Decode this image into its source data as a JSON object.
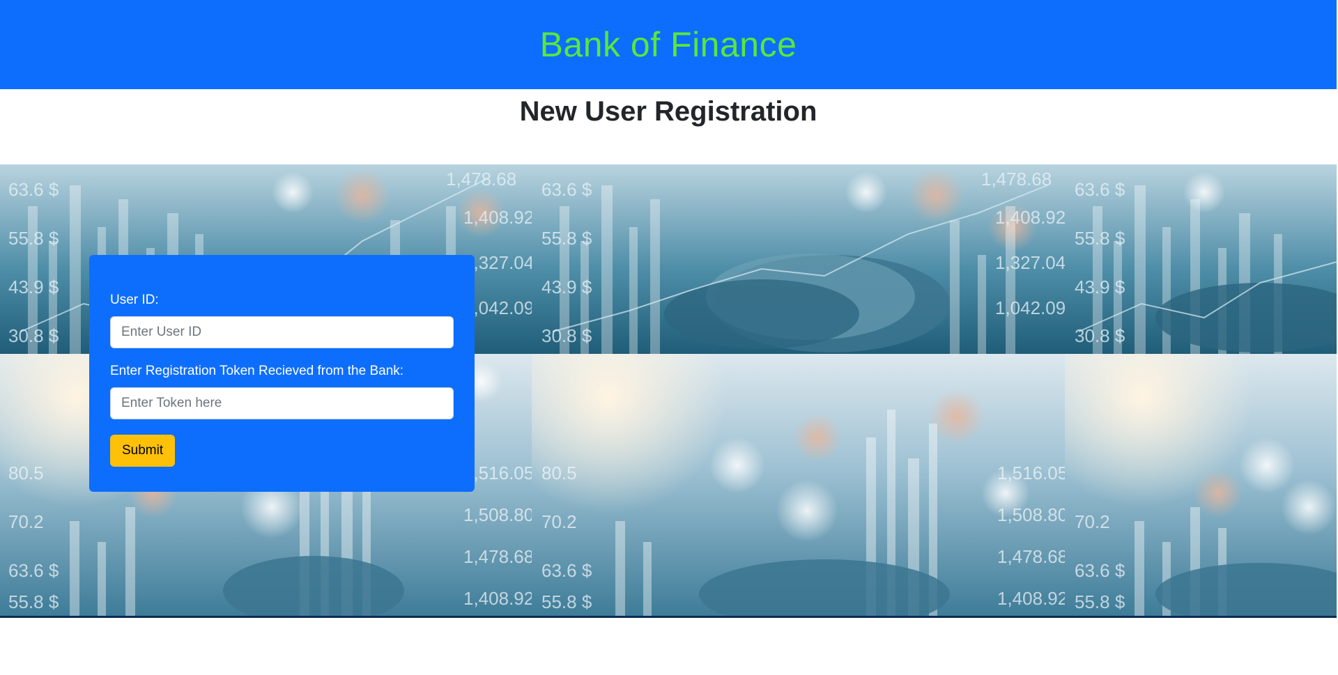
{
  "header": {
    "brand": "Bank of Finance",
    "brand_color": "#59e83a",
    "background_color": "#0d6efd"
  },
  "page": {
    "title": "New User Registration"
  },
  "hero": {
    "image": "coins-and-stock-chart-background",
    "chart_labels_top": [
      "63.6 $",
      "55.8 $",
      "43.9 $",
      "30.8 $",
      "1,478.68",
      "1,408.92",
      "1,327.04",
      "1,042.09"
    ],
    "chart_labels_bottom": [
      "80.5",
      "70.2",
      "63.6 $",
      "55.8 $",
      "1,516.05",
      "1,508.80",
      "1,478.68",
      "1,408.92"
    ]
  },
  "form": {
    "user_id_label": "User ID:",
    "user_id_placeholder": "Enter User ID",
    "user_id_value": "",
    "token_label": "Enter Registration Token Recieved from the Bank:",
    "token_placeholder": "Enter Token here",
    "token_value": "",
    "submit_label": "Submit",
    "card_color": "#0d6efd",
    "submit_color": "#ffc107"
  }
}
